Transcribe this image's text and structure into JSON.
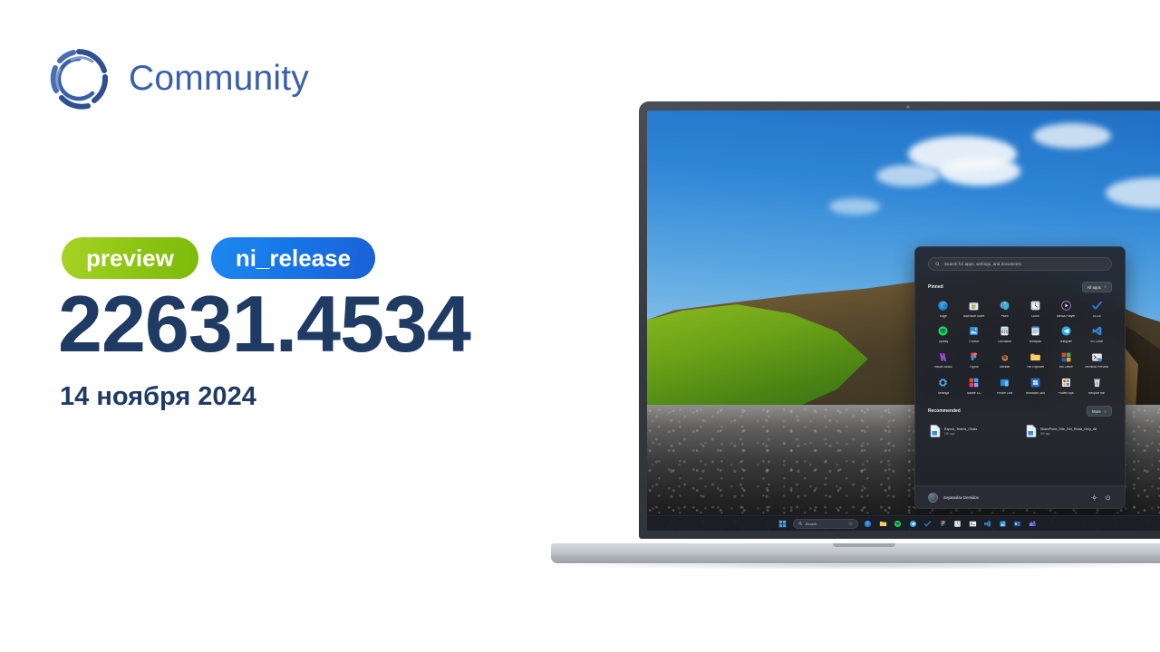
{
  "brand": {
    "name": "Community",
    "logo_icon": "community-circle-c-logo",
    "color": "#3a5ea8"
  },
  "release": {
    "badges": [
      {
        "label": "preview",
        "color": "#8cc412"
      },
      {
        "label": "ni_release",
        "color": "#1677e8"
      }
    ],
    "build_number": "22631.4534",
    "date": "14 ноября 2024",
    "text_color": "#1f3a63"
  },
  "device": {
    "type": "laptop",
    "camera_icon": "webcam-dot"
  },
  "wallpaper": {
    "scene": "black-sand-beach-cliff"
  },
  "start_menu": {
    "search": {
      "placeholder": "Search for apps, settings, and documents",
      "icon": "search-icon"
    },
    "pinned": {
      "title": "Pinned",
      "all_apps_label": "All apps",
      "all_apps_icon": "chevron-right-icon",
      "apps": [
        {
          "label": "Edge",
          "icon": "edge-icon"
        },
        {
          "label": "Microsoft Store",
          "icon": "microsoft-store-icon"
        },
        {
          "label": "Paint",
          "icon": "paint-icon"
        },
        {
          "label": "Clock",
          "icon": "clock-icon"
        },
        {
          "label": "Media Player",
          "icon": "media-player-icon"
        },
        {
          "label": "To Do",
          "icon": "to-do-icon"
        },
        {
          "label": "Spotify",
          "icon": "spotify-icon"
        },
        {
          "label": "Photos",
          "icon": "photos-icon"
        },
        {
          "label": "Calculator",
          "icon": "calculator-icon"
        },
        {
          "label": "Notepad",
          "icon": "notepad-icon"
        },
        {
          "label": "Telegram",
          "icon": "telegram-icon"
        },
        {
          "label": "VS Code",
          "icon": "vs-code-icon"
        },
        {
          "label": "Visual Studio",
          "icon": "visual-studio-icon"
        },
        {
          "label": "Figma",
          "icon": "figma-icon"
        },
        {
          "label": "Blender",
          "icon": "blender-icon"
        },
        {
          "label": "File Explorer",
          "icon": "file-explorer-icon"
        },
        {
          "label": "MS Office",
          "icon": "ms-office-icon"
        },
        {
          "label": "Terminal Preview",
          "icon": "terminal-preview-icon"
        },
        {
          "label": "Settings",
          "icon": "settings-gear-icon"
        },
        {
          "label": "Adobe CC",
          "icon": "adobe-cc-icon"
        },
        {
          "label": "Phone Link",
          "icon": "phone-link-icon"
        },
        {
          "label": "Windows 365",
          "icon": "windows-365-icon"
        },
        {
          "label": "PowerToys",
          "icon": "powertoys-icon"
        },
        {
          "label": "Recycle Bin",
          "icon": "recycle-bin-icon"
        }
      ]
    },
    "recommended": {
      "title": "Recommended",
      "more_label": "More",
      "more_icon": "chevron-right-icon",
      "items": [
        {
          "name": "Export_Teams_Chats",
          "time": "14h ago",
          "icon": "document-file-icon"
        },
        {
          "name": "SharePoint_Site_Set_Read_Only_All",
          "time": "19h ago",
          "icon": "document-file-icon"
        }
      ]
    },
    "footer": {
      "user_name": "Svyatoslav Demidov",
      "avatar_icon": "user-avatar",
      "settings_icon": "settings-gear-icon",
      "power_icon": "power-icon"
    }
  },
  "taskbar": {
    "start_icon": "windows-start-icon",
    "search": {
      "label": "Search",
      "icon": "search-icon",
      "mic_icon": "copilot-icon"
    },
    "apps": [
      {
        "icon": "edge-icon"
      },
      {
        "icon": "file-explorer-icon"
      },
      {
        "icon": "spotify-icon"
      },
      {
        "icon": "telegram-icon"
      },
      {
        "icon": "to-do-icon"
      },
      {
        "icon": "figma-icon"
      },
      {
        "icon": "clock-icon"
      },
      {
        "icon": "terminal-icon"
      },
      {
        "icon": "vs-code-icon"
      },
      {
        "icon": "photos-icon"
      },
      {
        "icon": "outlook-icon"
      },
      {
        "icon": "teams-icon"
      }
    ]
  }
}
